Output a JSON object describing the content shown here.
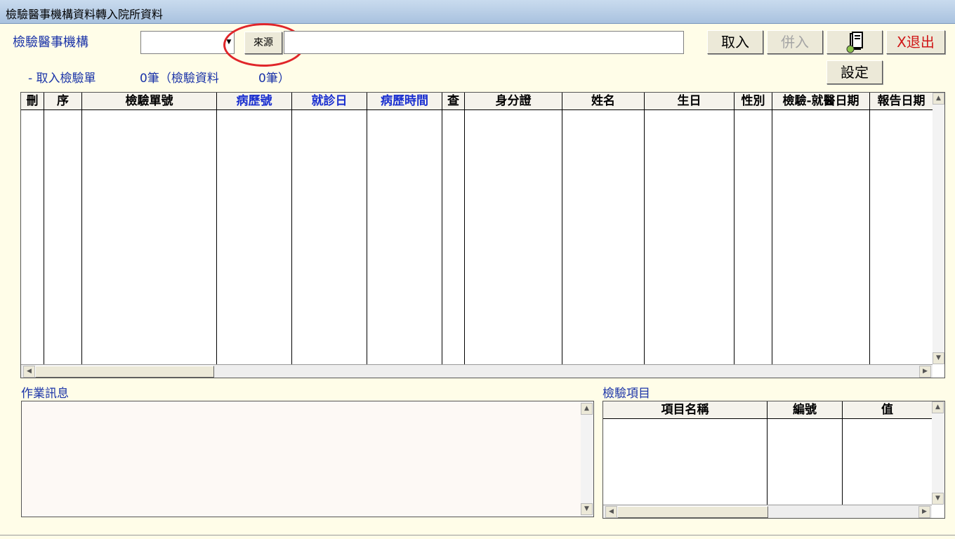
{
  "window": {
    "title": "檢驗醫事機構資料轉入院所資料"
  },
  "form": {
    "institution_label": "檢驗醫事機構",
    "source_button": "來源",
    "retrieved_summary": "-  取入檢驗單",
    "count_text": "0筆（檢驗資料",
    "count_text2": "0筆）"
  },
  "toolbar": {
    "import_label": "取入",
    "merge_label": "併入",
    "exit_label": "X退出",
    "settings_label": "設定"
  },
  "main_grid": {
    "columns": [
      "刪",
      "序",
      "檢驗單號",
      "病歷號",
      "就診日",
      "病歷時間",
      "查",
      "身分證",
      "姓名",
      "生日",
      "性別",
      "檢驗-就醫日期",
      "報告日期"
    ]
  },
  "messages": {
    "label": "作業訊息"
  },
  "items": {
    "label": "檢驗項目",
    "columns": [
      "項目名稱",
      "編號",
      "值"
    ]
  },
  "colors": {
    "accent": "#1a33a8",
    "exit": "#d01818",
    "highlight_circle": "#e0262a"
  }
}
